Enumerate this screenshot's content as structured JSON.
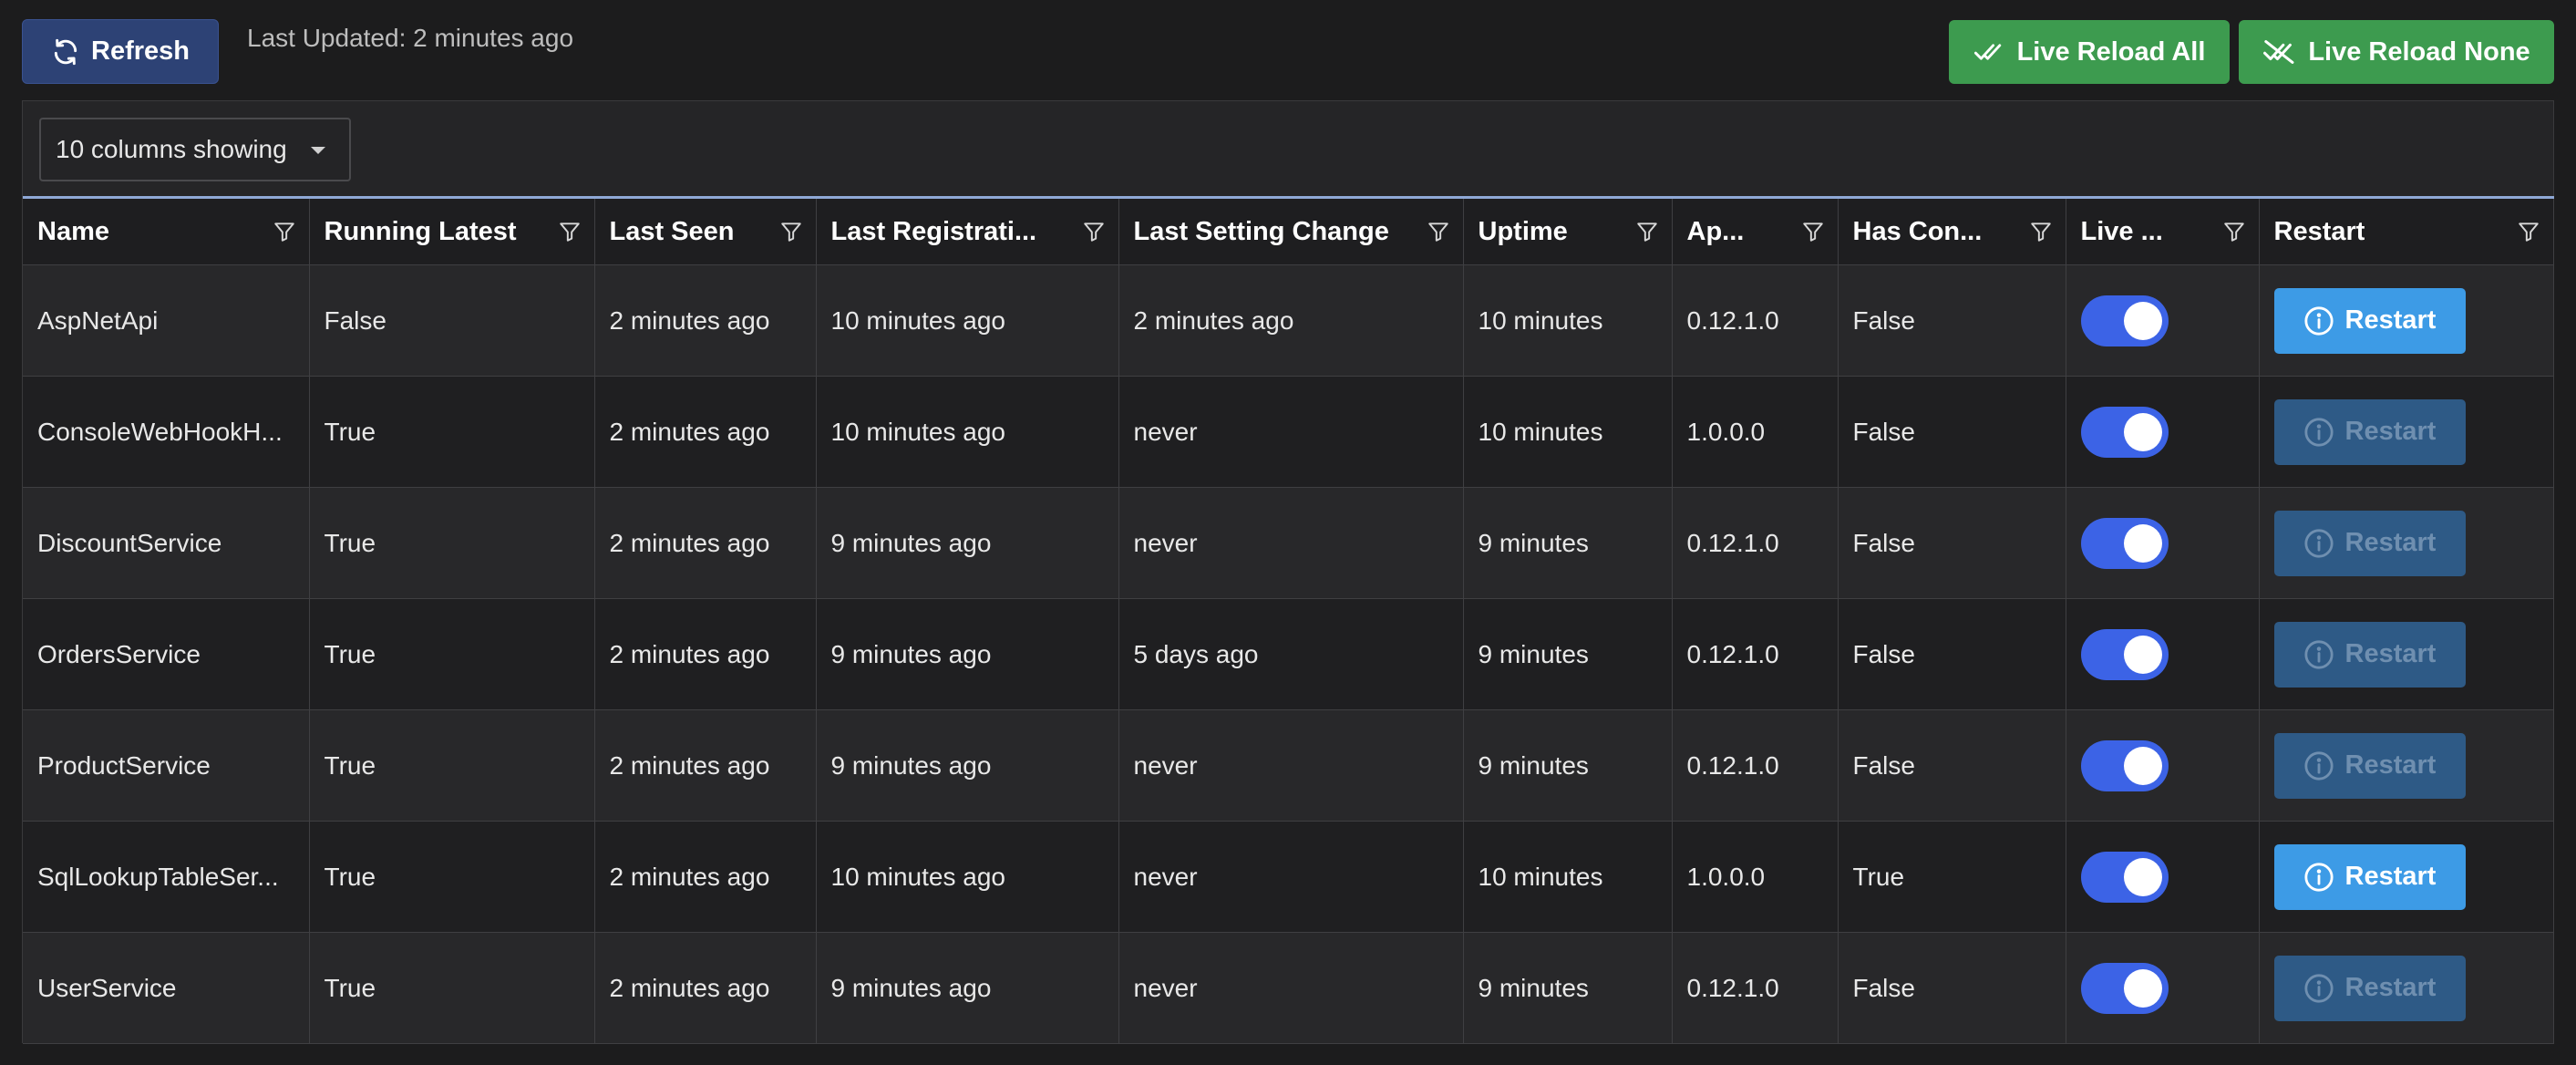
{
  "toolbar": {
    "refresh_label": "Refresh",
    "last_updated": "Last Updated: 2 minutes ago",
    "live_reload_all_label": "Live Reload All",
    "live_reload_none_label": "Live Reload None"
  },
  "table": {
    "column_selector": "10 columns showing",
    "headers": [
      "Name",
      "Running Latest",
      "Last Seen",
      "Last Registrati...",
      "Last Setting Change",
      "Uptime",
      "Ap...",
      "Has Con...",
      "Live ...",
      "Restart"
    ],
    "restart_label": "Restart",
    "rows": [
      {
        "name": "AspNetApi",
        "running_latest": "False",
        "last_seen": "2 minutes ago",
        "last_registration": "10 minutes ago",
        "last_setting_change": "2 minutes ago",
        "uptime": "10 minutes",
        "app_version": "0.12.1.0",
        "has_config": "False",
        "live_reload": true,
        "restart_enabled": true
      },
      {
        "name": "ConsoleWebHookH...",
        "running_latest": "True",
        "last_seen": "2 minutes ago",
        "last_registration": "10 minutes ago",
        "last_setting_change": "never",
        "uptime": "10 minutes",
        "app_version": "1.0.0.0",
        "has_config": "False",
        "live_reload": true,
        "restart_enabled": false
      },
      {
        "name": "DiscountService",
        "running_latest": "True",
        "last_seen": "2 minutes ago",
        "last_registration": "9 minutes ago",
        "last_setting_change": "never",
        "uptime": "9 minutes",
        "app_version": "0.12.1.0",
        "has_config": "False",
        "live_reload": true,
        "restart_enabled": false
      },
      {
        "name": "OrdersService",
        "running_latest": "True",
        "last_seen": "2 minutes ago",
        "last_registration": "9 minutes ago",
        "last_setting_change": "5 days ago",
        "uptime": "9 minutes",
        "app_version": "0.12.1.0",
        "has_config": "False",
        "live_reload": true,
        "restart_enabled": false
      },
      {
        "name": "ProductService",
        "running_latest": "True",
        "last_seen": "2 minutes ago",
        "last_registration": "9 minutes ago",
        "last_setting_change": "never",
        "uptime": "9 minutes",
        "app_version": "0.12.1.0",
        "has_config": "False",
        "live_reload": true,
        "restart_enabled": false
      },
      {
        "name": "SqlLookupTableSer...",
        "running_latest": "True",
        "last_seen": "2 minutes ago",
        "last_registration": "10 minutes ago",
        "last_setting_change": "never",
        "uptime": "10 minutes",
        "app_version": "1.0.0.0",
        "has_config": "True",
        "live_reload": true,
        "restart_enabled": true
      },
      {
        "name": "UserService",
        "running_latest": "True",
        "last_seen": "2 minutes ago",
        "last_registration": "9 minutes ago",
        "last_setting_change": "never",
        "uptime": "9 minutes",
        "app_version": "0.12.1.0",
        "has_config": "False",
        "live_reload": true,
        "restart_enabled": false
      }
    ]
  },
  "colors": {
    "background": "#1c1c1d",
    "refresh_button": "#2d4275",
    "live_reload_buttons": "#3d9b4f",
    "toggle_on": "#3c63e6",
    "restart_enabled": "#3d9be6",
    "restart_disabled": "#2e5a86"
  },
  "icons": {
    "refresh": "refresh-icon",
    "live_reload_all": "double-check-icon",
    "live_reload_none": "double-check-off-icon",
    "column_filter": "filter-icon",
    "restart": "info-icon"
  }
}
